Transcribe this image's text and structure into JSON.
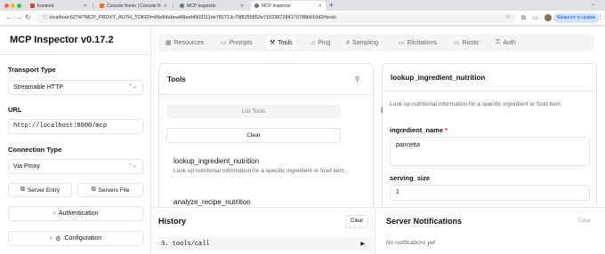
{
  "browser": {
    "tabs": [
      {
        "label": "frontend",
        "color": "#d1453b"
      },
      {
        "label": "Console Home | Console Ho...",
        "color": "#e8710a"
      },
      {
        "label": "MCP Inspector",
        "color": "#6b7280"
      },
      {
        "label": "MCP Inspector",
        "color": "#6b7280"
      }
    ],
    "url": "localhost:6274/?MCP_PROXY_AUTH_TOKEN=d9e84abea48bed4903111de782713c79f8255852e7153387284170788b916d2#tools",
    "relaunch_label": "Relaunch to update"
  },
  "sidebar": {
    "title": "MCP Inspector v0.17.2",
    "transport_label": "Transport Type",
    "transport_value": "Streamable HTTP",
    "url_label": "URL",
    "url_value": "http://localhost:8000/mcp",
    "connection_label": "Connection Type",
    "connection_value": "Via Proxy",
    "server_entry_label": "Server Entry",
    "servers_file_label": "Servers File",
    "authentication_label": "Authentication",
    "configuration_label": "Configuration"
  },
  "nav": {
    "tabs": [
      {
        "label": "Resources",
        "icon": "resources-icon",
        "glyph": "▦"
      },
      {
        "label": "Prompts",
        "icon": "prompts-icon",
        "glyph": "▭"
      },
      {
        "label": "Tools",
        "icon": "wrench-icon",
        "glyph": "🔧"
      },
      {
        "label": "Ping",
        "icon": "bell-icon",
        "glyph": "🔔"
      },
      {
        "label": "Sampling",
        "icon": "hash-icon",
        "glyph": "#"
      },
      {
        "label": "Elicitations",
        "icon": "message-icon",
        "glyph": "▭"
      },
      {
        "label": "Roots",
        "icon": "folder-icon",
        "glyph": "▭"
      },
      {
        "label": "Auth",
        "icon": "key-icon",
        "glyph": "⚿"
      }
    ],
    "active": "Tools"
  },
  "tools_panel": {
    "title": "Tools",
    "list_tools_label": "List Tools",
    "clear_label": "Clear",
    "items": [
      {
        "name": "lookup_ingredient_nutrition",
        "description": "Look up nutritional information for a specific ingredient or food item"
      },
      {
        "name": "analyze_recipe_nutrition",
        "description": ""
      }
    ]
  },
  "detail_panel": {
    "title": "lookup_ingredient_nutrition",
    "description": "Look up nutritional information for a specific ingredient or food item",
    "param1_label": "ingredient_name",
    "param1_required": "*",
    "param1_value": "pancetta",
    "param2_label": "serving_size",
    "param2_value": "1"
  },
  "history": {
    "title": "History",
    "clear_label": "Clear",
    "entries": [
      {
        "label": "3. tools/call"
      }
    ]
  },
  "notifications": {
    "title": "Server Notifications",
    "clear_label": "Clear",
    "empty_text": "No notifications yet"
  }
}
